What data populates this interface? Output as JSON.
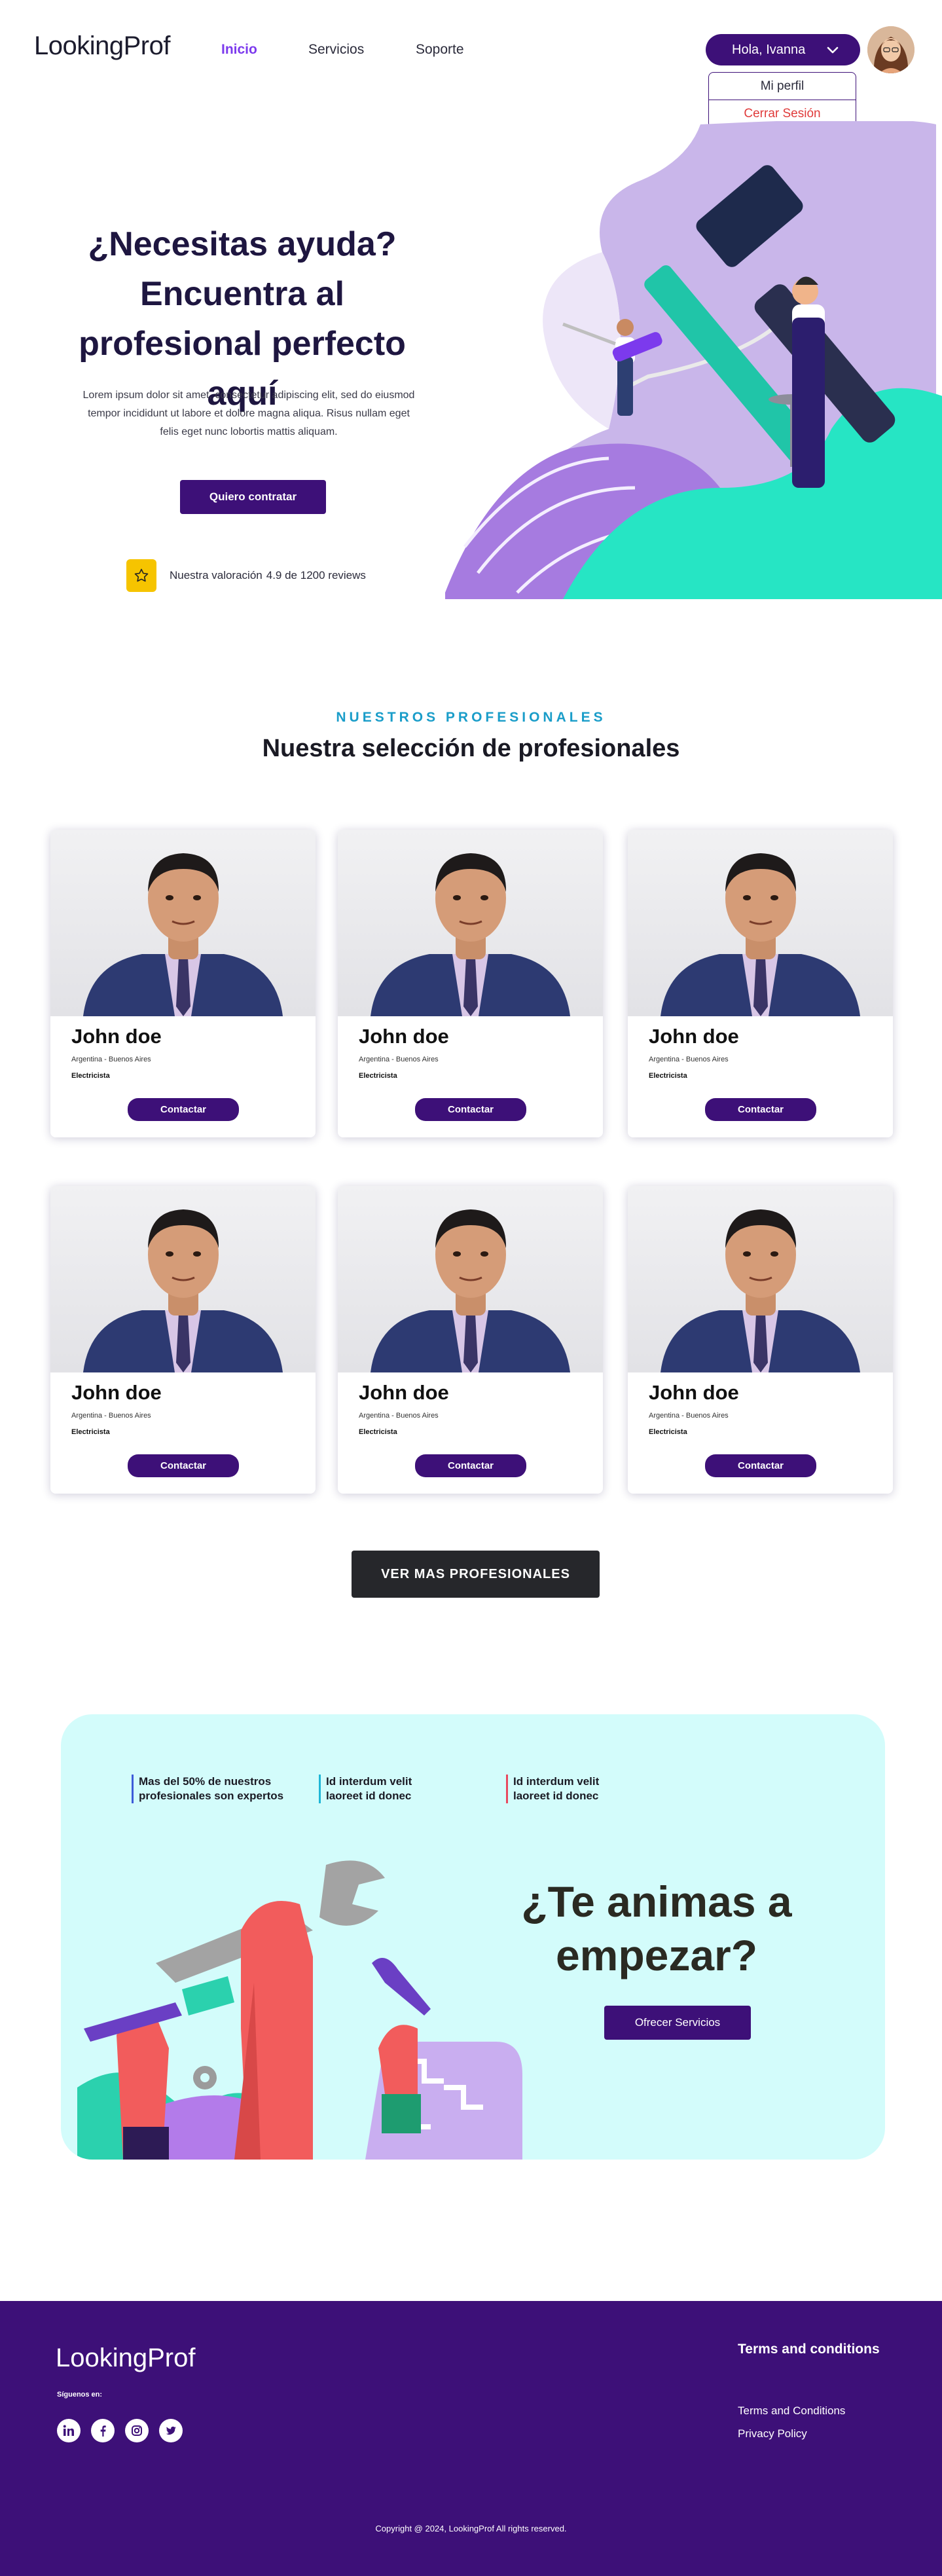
{
  "header": {
    "logo": "LookingProf",
    "nav": [
      {
        "label": "Inicio",
        "active": true
      },
      {
        "label": "Servicios",
        "active": false
      },
      {
        "label": "Soporte",
        "active": false
      }
    ],
    "user_greeting": "Hola, Ivanna",
    "dropdown": {
      "profile": "Mi perfil",
      "logout": "Cerrar Sesión"
    }
  },
  "hero": {
    "title": "¿Necesitas ayuda? Encuentra al profesional perfecto aquí",
    "text": "Lorem ipsum dolor sit amet, consectetur adipiscing elit, sed do eiusmod tempor incididunt ut labore et dolore magna aliqua. Risus nullam eget felis eget nunc lobortis mattis aliquam.",
    "cta": "Quiero contratar",
    "rating_label": "Nuestra valoración",
    "rating_value": "4.9 de 1200 reviews"
  },
  "professionals": {
    "eyebrow": "NUESTROS PROFESIONALES",
    "title": "Nuestra selección de profesionales",
    "cards": [
      {
        "name": "John doe",
        "location": "Argentina - Buenos Aires",
        "role": "Electricista",
        "button": "Contactar"
      },
      {
        "name": "John doe",
        "location": "Argentina - Buenos Aires",
        "role": "Electricista",
        "button": "Contactar"
      },
      {
        "name": "John doe",
        "location": "Argentina - Buenos Aires",
        "role": "Electricista",
        "button": "Contactar"
      },
      {
        "name": "John doe",
        "location": "Argentina - Buenos Aires",
        "role": "Electricista",
        "button": "Contactar"
      },
      {
        "name": "John doe",
        "location": "Argentina - Buenos Aires",
        "role": "Electricista",
        "button": "Contactar"
      },
      {
        "name": "John doe",
        "location": "Argentina - Buenos Aires",
        "role": "Electricista",
        "button": "Contactar"
      }
    ],
    "more_button": "VER MAS PROFESIONALES"
  },
  "cta": {
    "stats": [
      {
        "line1": "Mas del 50% de nuestros",
        "line2": "profesionales son expertos",
        "color": "#3d5bd9"
      },
      {
        "line1": "Id interdum velit",
        "line2": "laoreet id donec",
        "color": "#1fb6d6"
      },
      {
        "line1": "Id interdum velit",
        "line2": "laoreet id donec",
        "color": "#e84a5f"
      }
    ],
    "title": "¿Te animas a empezar?",
    "button": "Ofrecer Servicios"
  },
  "footer": {
    "logo": "LookingProf",
    "follow": "Síguenos en:",
    "socials": [
      "linkedin-icon",
      "facebook-icon",
      "instagram-icon",
      "twitter-icon"
    ],
    "links_title": "Terms and conditions",
    "links": [
      "Terms and Conditions",
      "Privacy Policy"
    ],
    "copyright": "Copyright @ 2024, LookingProf All rights reserved."
  },
  "colors": {
    "primary": "#3d1078",
    "accent_active": "#7c3aed",
    "eyebrow": "#1a9dc9",
    "cta_bg": "#d3fcfb",
    "rating_star_bg": "#f6c400",
    "logout": "#e03b3b"
  }
}
